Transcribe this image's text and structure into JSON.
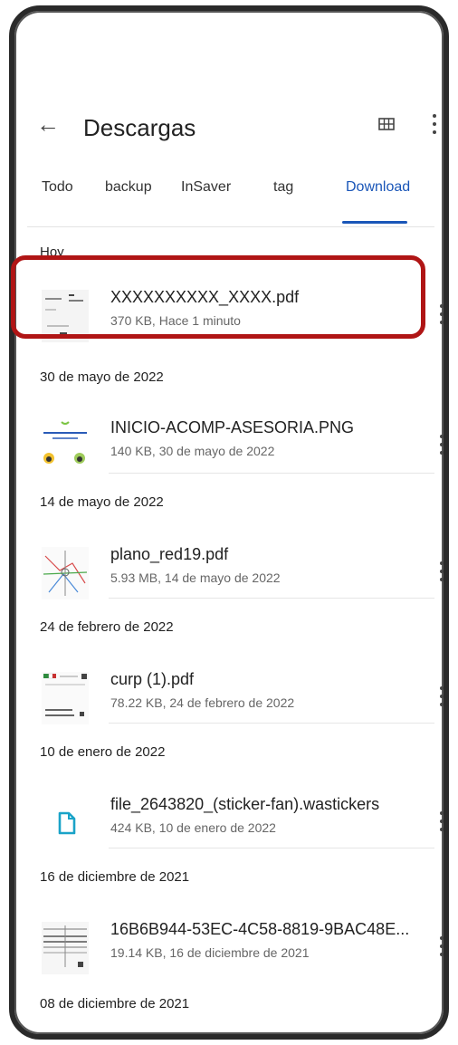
{
  "header": {
    "back_icon": "←",
    "title": "Descargas"
  },
  "tabs": [
    "Todo",
    "backup",
    "InSaver",
    "tag",
    "Download"
  ],
  "active_tab": "Download",
  "sections": [
    {
      "label": "Hoy",
      "items": [
        {
          "name": "XXXXXXXXXX_XXXX.pdf",
          "meta": "370 KB, Hace 1 minuto",
          "thumb": "pdf-doc"
        }
      ]
    },
    {
      "label": "30 de mayo de 2022",
      "items": [
        {
          "name": "INICIO-ACOMP-ASESORIA.PNG",
          "meta": "140 KB, 30 de mayo de 2022",
          "thumb": "image"
        }
      ]
    },
    {
      "label": "14 de mayo de 2022",
      "items": [
        {
          "name": "plano_red19.pdf",
          "meta": "5.93 MB, 14 de mayo de 2022",
          "thumb": "map"
        }
      ]
    },
    {
      "label": "24 de febrero de 2022",
      "items": [
        {
          "name": "curp (1).pdf",
          "meta": "78.22 KB, 24 de febrero de 2022",
          "thumb": "doc"
        }
      ]
    },
    {
      "label": "10 de enero de 2022",
      "items": [
        {
          "name": "file_2643820_(sticker-fan).wastickers",
          "meta": "424 KB, 10 de enero de 2022",
          "thumb": "file-icon"
        }
      ]
    },
    {
      "label": "16 de diciembre de 2021",
      "items": [
        {
          "name": "16B6B944-53EC-4C58-8819-9BAC48E...",
          "meta": "19.14 KB, 16 de diciembre de 2021",
          "thumb": "table"
        }
      ]
    },
    {
      "label": "08 de diciembre de 2021",
      "items": []
    }
  ],
  "colors": {
    "accent": "#1a56b8",
    "highlight": "#b01515"
  }
}
